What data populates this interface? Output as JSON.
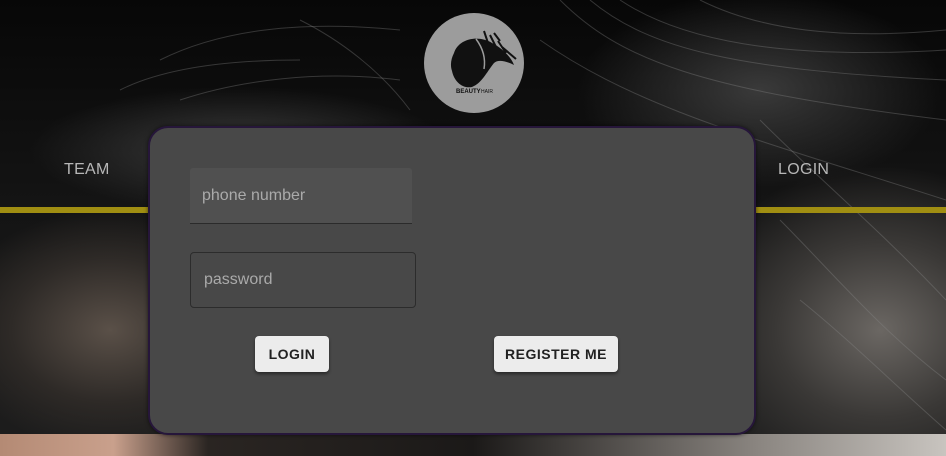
{
  "nav": {
    "left_label": "TEAM",
    "right_label": "LOGIN"
  },
  "logo": {
    "icon": "hair-salon-logo",
    "text_primary": "BEAUTY",
    "text_secondary": "HAIR"
  },
  "form": {
    "phone_placeholder": "phone number",
    "password_placeholder": "password",
    "login_label": "LOGIN",
    "register_label": "REGISTER ME"
  },
  "colors": {
    "accent_line": "#a08e12",
    "modal_bg": "#484848",
    "button_bg": "#ececec"
  }
}
